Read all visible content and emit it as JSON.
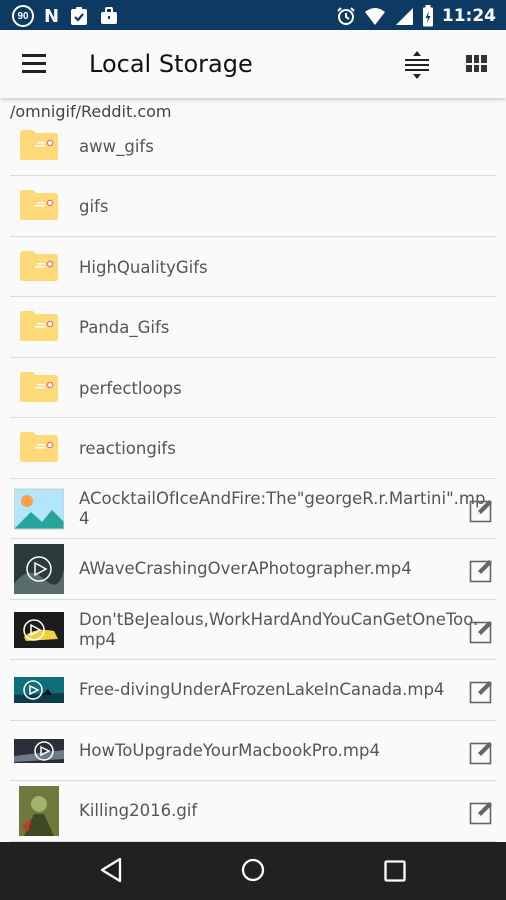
{
  "status_bar": {
    "notification_badge": "90",
    "n_glyph": "N",
    "time": "11:24",
    "icons": [
      "badge-90-icon",
      "n-icon",
      "clipboard-check-icon",
      "briefcase-icon",
      "alarm-icon",
      "wifi-icon",
      "signal-icon",
      "battery-icon"
    ]
  },
  "app_bar": {
    "title": "Local Storage",
    "icons": [
      "menu-icon",
      "sort-icon",
      "grid-view-icon"
    ]
  },
  "path": "/omnigif/Reddit.com",
  "folders": [
    {
      "name": "aww_gifs"
    },
    {
      "name": "gifs"
    },
    {
      "name": "HighQualityGifs"
    },
    {
      "name": "Panda_Gifs"
    },
    {
      "name": "perfectloops"
    },
    {
      "name": "reactiongifs"
    }
  ],
  "files": [
    {
      "line1": "ACocktailOfIceAndFire:The\"georgeR.r.Martini\".mp",
      "line2": "4",
      "thumb": "image-placeholder-icon"
    },
    {
      "line1": "AWaveCrashingOverAPhotographer.mp4",
      "line2": "",
      "thumb": "video"
    },
    {
      "line1": "Don'tBeJealous,WorkHardAndYouCanGetOneToo.",
      "line2": "mp4",
      "thumb": "video"
    },
    {
      "line1": "Free-divingUnderAFrozenLakeInCanada.mp4",
      "line2": "",
      "thumb": "video"
    },
    {
      "line1": "HowToUpgradeYourMacbookPro.mp4",
      "line2": "",
      "thumb": "video"
    },
    {
      "line1": "Killing2016.gif",
      "line2": "",
      "thumb": "image"
    }
  ],
  "colors": {
    "status_bar": "#0d3a63",
    "folder": "#ffd97a",
    "folder_dot": "#e57373",
    "nav_bar": "#212121"
  }
}
